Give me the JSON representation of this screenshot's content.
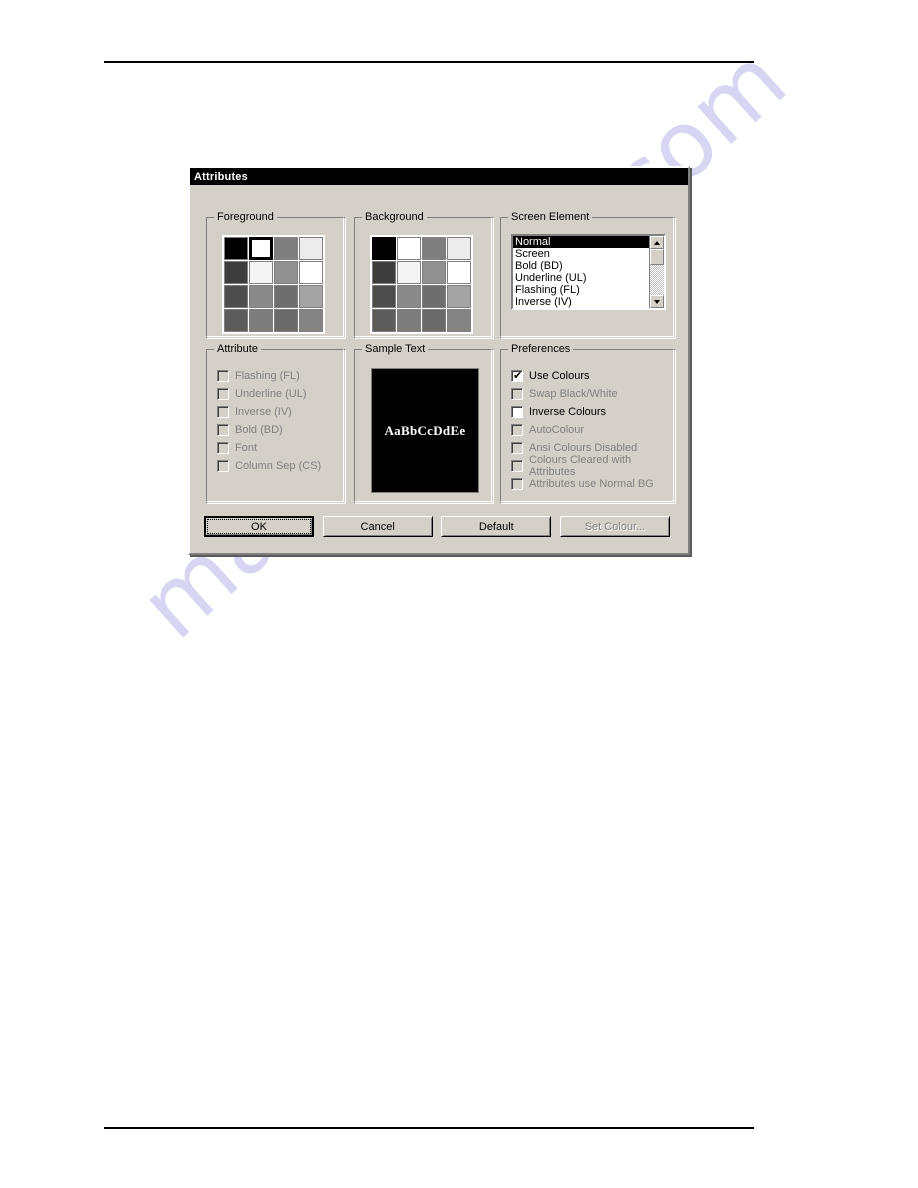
{
  "page": {
    "watermark": "manualshive.com"
  },
  "dialog": {
    "title": "Attributes",
    "foreground": {
      "legend": "Foreground",
      "selected_index": 1,
      "swatches": [
        "#000000",
        "#ffffff",
        "#7f7f7f",
        "#ececec",
        "#3d3d3d",
        "#f4f4f4",
        "#909090",
        "#ffffff",
        "#4d4d4d",
        "#8a8a8a",
        "#6e6e6e",
        "#a4a4a4",
        "#5c5c5c",
        "#7c7c7c",
        "#6a6a6a",
        "#848484"
      ]
    },
    "background": {
      "legend": "Background",
      "selected_index": 0,
      "swatches": [
        "#000000",
        "#ffffff",
        "#7f7f7f",
        "#ececec",
        "#3d3d3d",
        "#f4f4f4",
        "#909090",
        "#ffffff",
        "#4d4d4d",
        "#8a8a8a",
        "#6e6e6e",
        "#a4a4a4",
        "#5c5c5c",
        "#7c7c7c",
        "#6a6a6a",
        "#848484"
      ]
    },
    "screen_element": {
      "legend": "Screen Element",
      "selected": "Normal",
      "items": [
        "Normal",
        "Screen",
        "Bold (BD)",
        "Underline (UL)",
        "Flashing (FL)",
        "Inverse (IV)"
      ]
    },
    "attribute": {
      "legend": "Attribute",
      "items": [
        {
          "label": "Flashing (FL)",
          "checked": false,
          "enabled": false
        },
        {
          "label": "Underline (UL)",
          "checked": false,
          "enabled": false
        },
        {
          "label": "Inverse (IV)",
          "checked": false,
          "enabled": false
        },
        {
          "label": "Bold (BD)",
          "checked": false,
          "enabled": false
        },
        {
          "label": "Font",
          "checked": false,
          "enabled": false
        },
        {
          "label": "Column Sep (CS)",
          "checked": false,
          "enabled": false
        }
      ]
    },
    "sample": {
      "legend": "Sample Text",
      "text": "AaBbCcDdEe",
      "foreground_colour": "#ffffff",
      "background_colour": "#000000"
    },
    "preferences": {
      "legend": "Preferences",
      "items": [
        {
          "label": "Use Colours",
          "checked": true,
          "enabled": true
        },
        {
          "label": "Swap Black/White",
          "checked": false,
          "enabled": false
        },
        {
          "label": "Inverse Colours",
          "checked": false,
          "enabled": true
        },
        {
          "label": "AutoColour",
          "checked": false,
          "enabled": false
        },
        {
          "label": "Ansi Colours Disabled",
          "checked": false,
          "enabled": false
        },
        {
          "label": "Colours Cleared with Attributes",
          "checked": false,
          "enabled": false
        },
        {
          "label": "Attributes use Normal BG",
          "checked": false,
          "enabled": false
        }
      ]
    },
    "buttons": [
      {
        "label": "OK",
        "default": true,
        "enabled": true
      },
      {
        "label": "Cancel",
        "default": false,
        "enabled": true
      },
      {
        "label": "Default",
        "default": false,
        "enabled": true
      },
      {
        "label": "Set Colour...",
        "default": false,
        "enabled": false
      }
    ]
  }
}
